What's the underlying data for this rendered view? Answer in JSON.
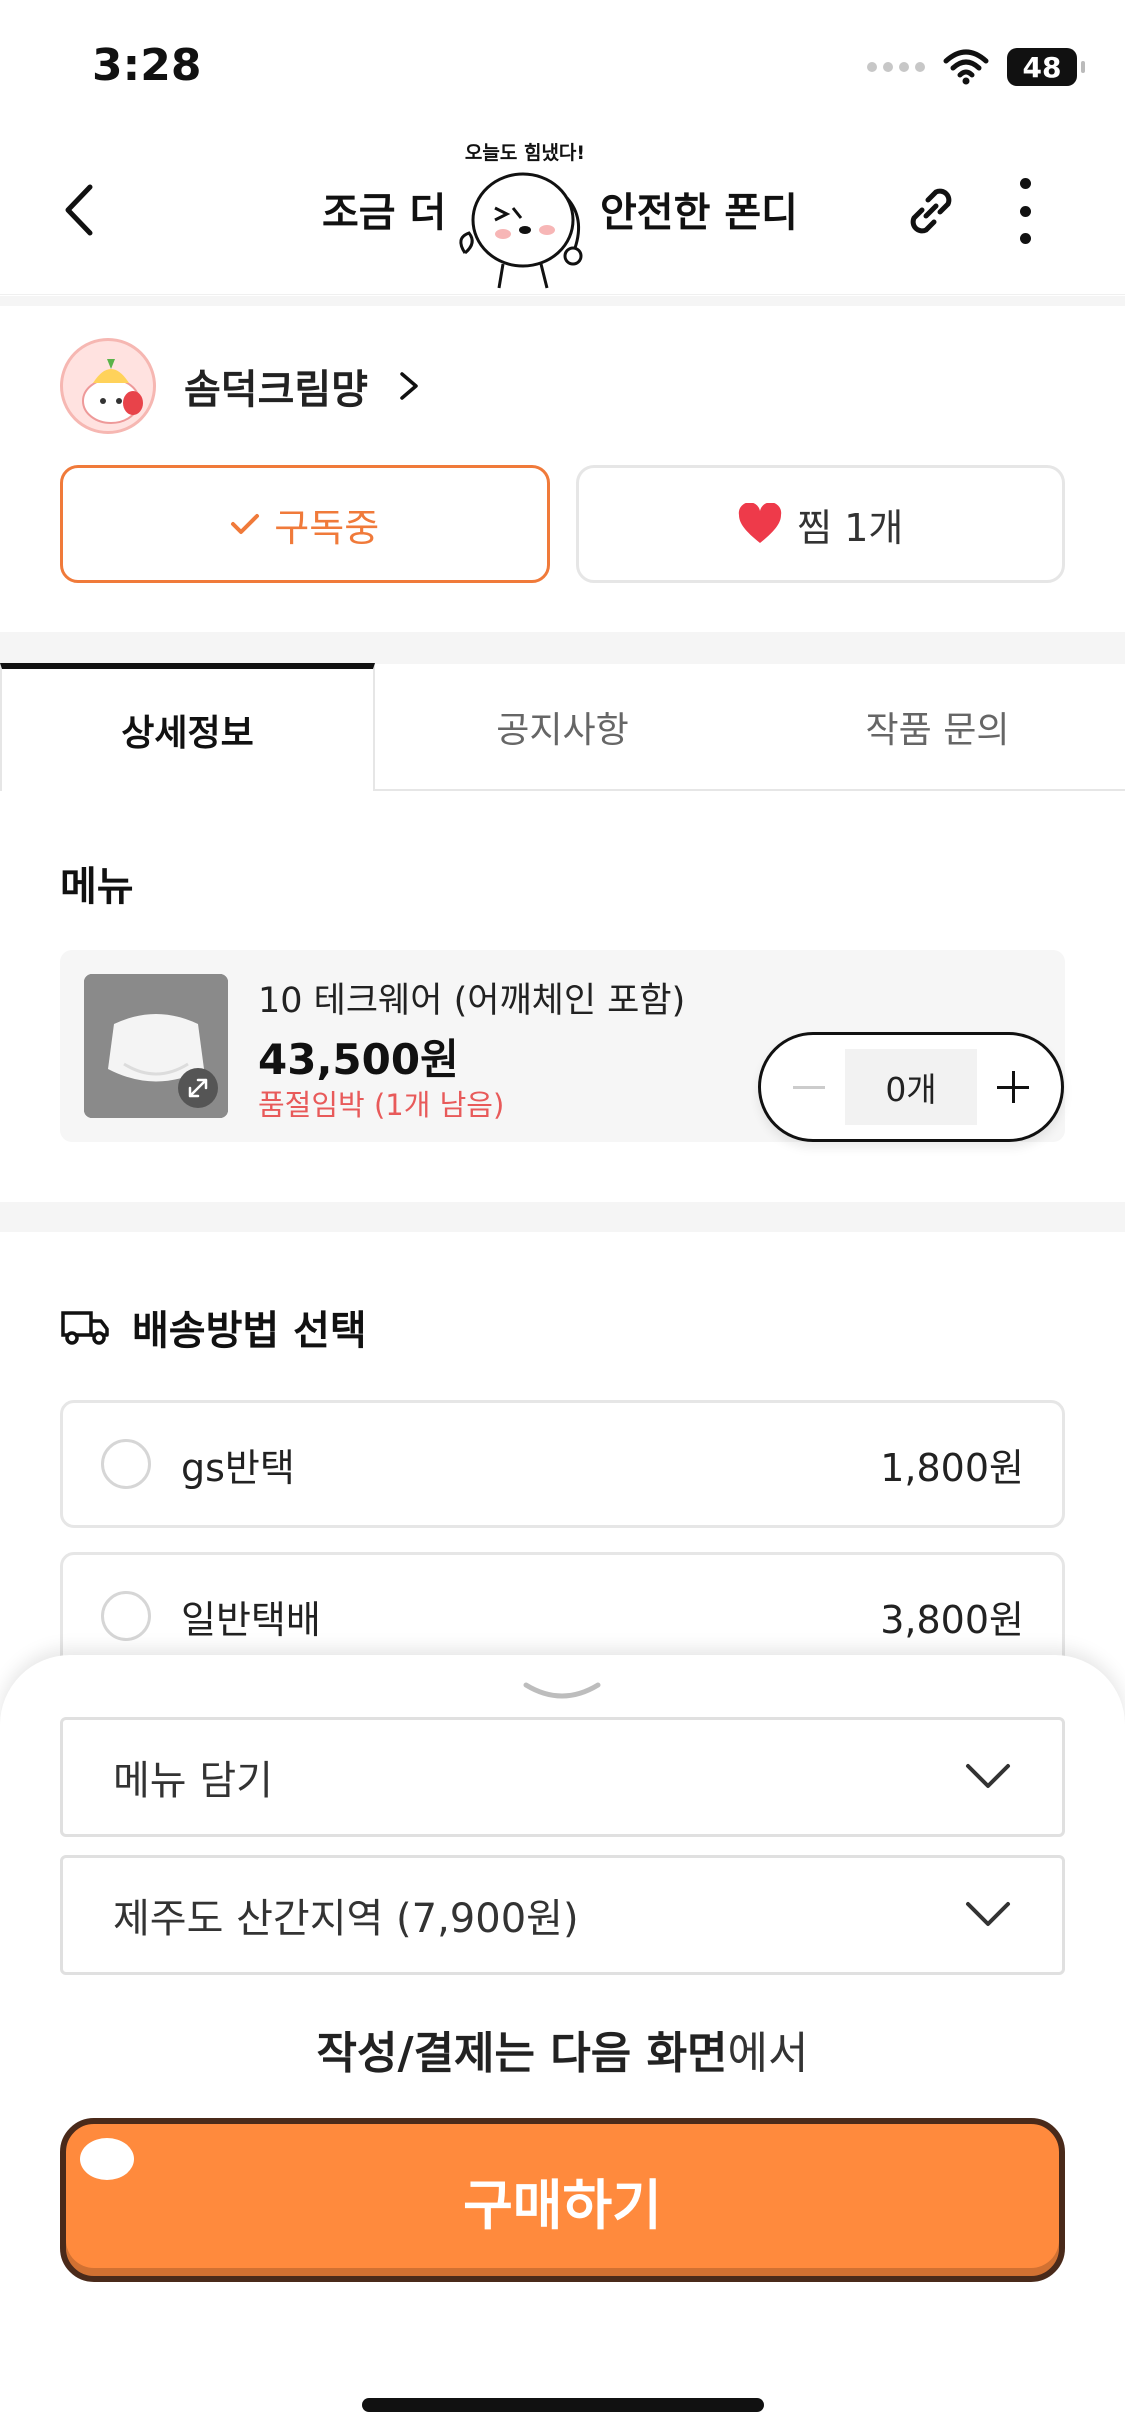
{
  "status_bar": {
    "time": "3:28",
    "battery": "48",
    "icons": [
      "signal-dots-icon",
      "wifi-icon",
      "battery-icon"
    ]
  },
  "header": {
    "title_left": "조금 더",
    "title_right": "안전한 폰디",
    "mascot_caption": "오늘도 힘냈다!",
    "icons": [
      "back-chevron-icon",
      "link-icon",
      "more-vertical-icon"
    ]
  },
  "profile": {
    "name": "솜덕크림먕"
  },
  "actions": {
    "subscribe_label": "구독중",
    "like_label": "찜 1개"
  },
  "tabs": [
    {
      "label": "상세정보",
      "active": true
    },
    {
      "label": "공지사항",
      "active": false
    },
    {
      "label": "작품 문의",
      "active": false
    }
  ],
  "menu": {
    "section_title": "메뉴",
    "item": {
      "name": "10 테크웨어 (어깨체인 포함)",
      "price": "43,500원",
      "stock": "품절임박 (1개 남음)",
      "quantity": "0개"
    }
  },
  "delivery": {
    "section_title": "배송방법 선택",
    "options": [
      {
        "name": "gs반택",
        "price": "1,800원"
      },
      {
        "name": "일반택배",
        "price": "3,800원"
      }
    ]
  },
  "sheet": {
    "menu_select": "메뉴 담기",
    "region_select": "제주도 산간지역 (7,900원)",
    "note_bold": "작성/결제는 다음 화면",
    "note_regular": "에서",
    "buy_label": "구매하기"
  },
  "colors": {
    "accent": "#f07a3a",
    "buy_button": "#ff8a3d",
    "warning": "#e85a5a",
    "heart": "#ee3a4a"
  }
}
